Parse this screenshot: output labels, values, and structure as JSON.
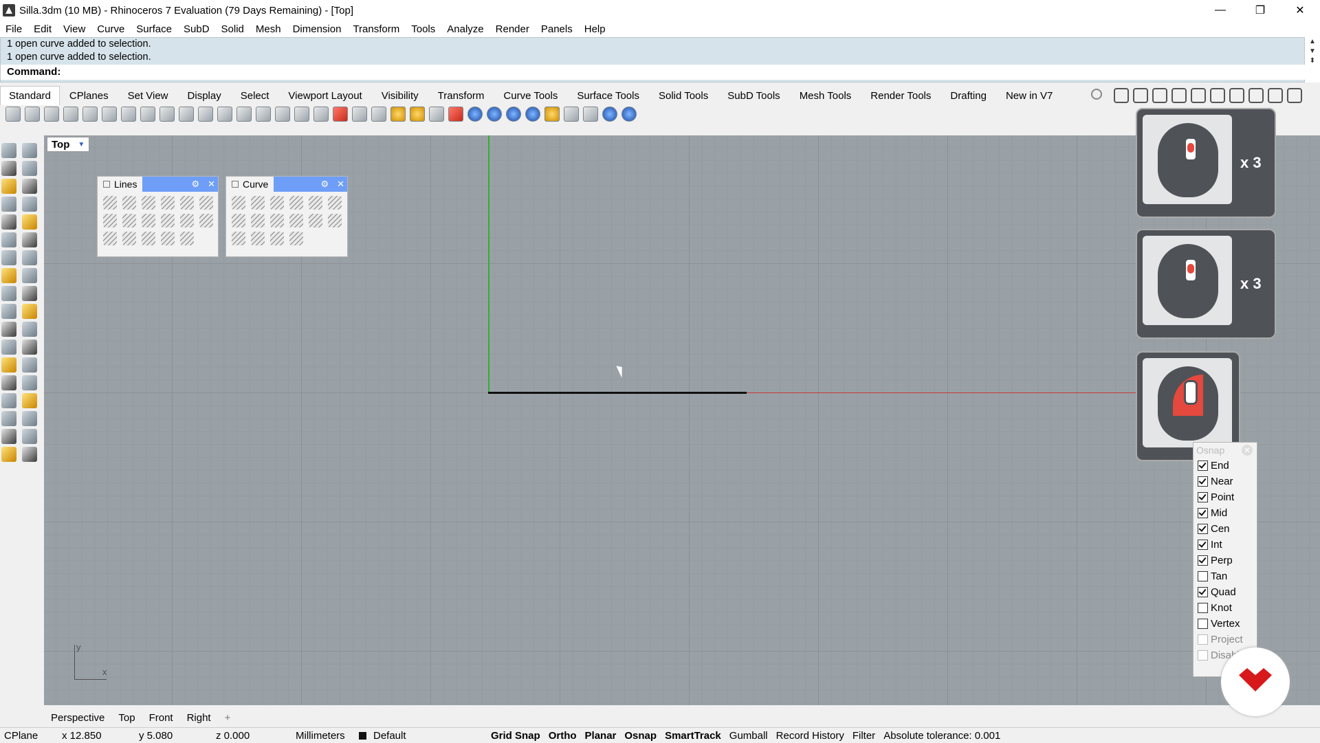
{
  "window": {
    "title": "Silla.3dm (10 MB) - Rhinoceros 7 Evaluation (79 Days Remaining) - [Top]",
    "controls": [
      "—",
      "❐",
      "✕"
    ]
  },
  "menu": [
    "File",
    "Edit",
    "View",
    "Curve",
    "Surface",
    "SubD",
    "Solid",
    "Mesh",
    "Dimension",
    "Transform",
    "Tools",
    "Analyze",
    "Render",
    "Panels",
    "Help"
  ],
  "command_history": [
    "1 open curve added to selection.",
    "1 open curve added to selection."
  ],
  "command_prompt": "Command:",
  "toolbar_tabs": [
    "Standard",
    "CPlanes",
    "Set View",
    "Display",
    "Select",
    "Viewport Layout",
    "Visibility",
    "Transform",
    "Curve Tools",
    "Surface Tools",
    "Solid Tools",
    "SubD Tools",
    "Mesh Tools",
    "Render Tools",
    "Drafting",
    "New in V7"
  ],
  "viewport": {
    "label": "Top",
    "axis_x": "x",
    "axis_y": "y"
  },
  "panels": {
    "lines": {
      "title": "Lines"
    },
    "curve": {
      "title": "Curve"
    }
  },
  "mouse_overlays": [
    {
      "count": "x 3"
    },
    {
      "count": "x 3"
    }
  ],
  "osnap": {
    "title": "Osnap",
    "items": [
      {
        "label": "End",
        "checked": true
      },
      {
        "label": "Near",
        "checked": true
      },
      {
        "label": "Point",
        "checked": true
      },
      {
        "label": "Mid",
        "checked": true
      },
      {
        "label": "Cen",
        "checked": true
      },
      {
        "label": "Int",
        "checked": true
      },
      {
        "label": "Perp",
        "checked": true
      },
      {
        "label": "Tan",
        "checked": false
      },
      {
        "label": "Quad",
        "checked": true
      },
      {
        "label": "Knot",
        "checked": false
      },
      {
        "label": "Vertex",
        "checked": false
      },
      {
        "label": "Project",
        "checked": false
      },
      {
        "label": "Disable",
        "checked": false
      }
    ]
  },
  "view_tabs": [
    "Perspective",
    "Top",
    "Front",
    "Right",
    "+"
  ],
  "status": {
    "cplane": "CPlane",
    "x": "x 12.850",
    "y": "y 5.080",
    "z": "z 0.000",
    "units": "Millimeters",
    "layer": "Default",
    "grid_snap": "Grid Snap",
    "ortho": "Ortho",
    "planar": "Planar",
    "osnap": "Osnap",
    "smarttrack": "SmartTrack",
    "gumball": "Gumball",
    "record_history": "Record History",
    "filter": "Filter",
    "tolerance": "Absolute tolerance: 0.001"
  },
  "colors": {
    "viewport_bg": "#9aa1a6",
    "y_axis": "#2fb02f",
    "x_axis": "#c43a3a",
    "panel_header": "#6e9ef8",
    "brand_red": "#d7191c"
  }
}
